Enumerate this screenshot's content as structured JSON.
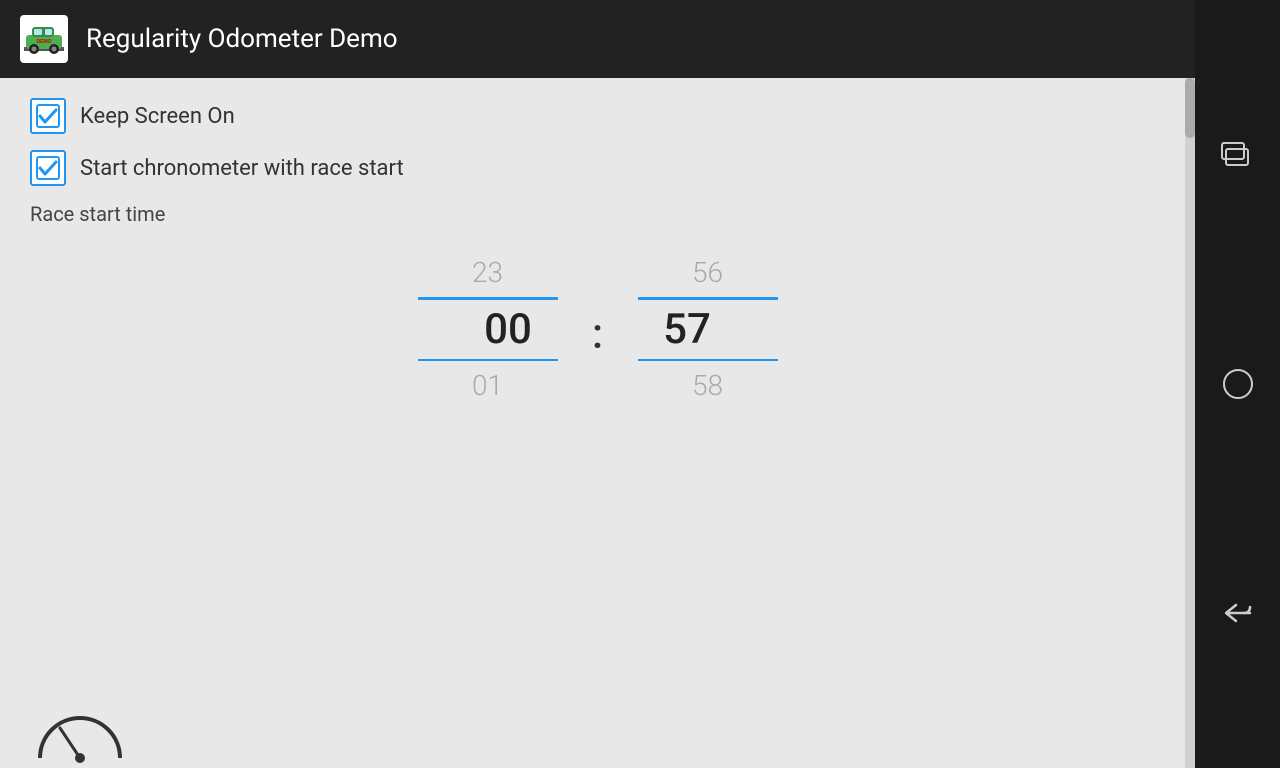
{
  "header": {
    "title": "Regularity Odometer Demo",
    "app_icon_label": "DEMO"
  },
  "settings": {
    "keep_screen_on_label": "Keep Screen On",
    "keep_screen_on_checked": true,
    "start_chrono_label": "Start chronometer with race start",
    "start_chrono_checked": true,
    "race_start_time_label": "Race start time"
  },
  "time_picker": {
    "hours_above": "23",
    "hours_value": "00",
    "hours_below": "01",
    "minutes_above": "56",
    "minutes_value": "57",
    "minutes_below": "58",
    "separator": ":"
  },
  "nav": {
    "recent_apps_label": "Recent Apps",
    "home_label": "Home",
    "back_label": "Back"
  }
}
